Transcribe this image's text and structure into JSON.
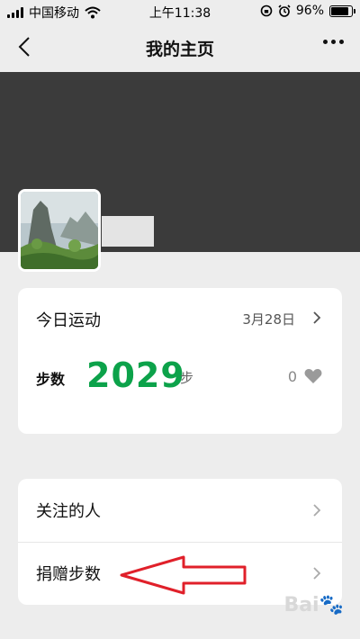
{
  "status_bar": {
    "carrier": "中国移动",
    "time": "上午11:38",
    "battery_percent": "96%",
    "battery_level": 0.96,
    "icons": [
      "signal-bars",
      "wifi-icon",
      "rotation-lock-icon",
      "alarm-icon",
      "battery-icon"
    ]
  },
  "navbar": {
    "title": "我的主页",
    "back_icon": "chevron-left-icon",
    "more_icon": "more-dots-icon"
  },
  "profile": {
    "cover_color": "#3b3b3b",
    "avatar": "mountain-landscape-avatar"
  },
  "today_sport": {
    "title": "今日运动",
    "date": "3月28日",
    "steps_label": "步数",
    "steps_value": "2029",
    "steps_unit": "步",
    "likes_count": "0",
    "accent_color": "#0ca24a"
  },
  "menu": {
    "items": [
      {
        "label": "关注的人"
      },
      {
        "label": "捐赠步数"
      }
    ]
  },
  "annotation": {
    "arrow_color": "#e0202a"
  }
}
